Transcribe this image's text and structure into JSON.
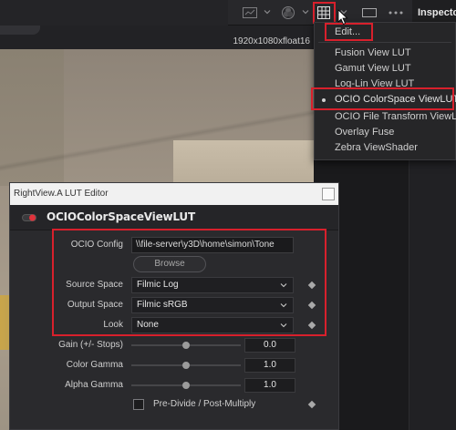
{
  "toolbar": {
    "inspector_label": "Inspecto",
    "icons": [
      "histogram-icon",
      "color-wheel-icon",
      "lut-grid-icon",
      "aspect-frame-icon",
      "more-icon"
    ],
    "accent_color": "#d8202c"
  },
  "viewer": {
    "resolution": "1920x1080xfloat16"
  },
  "lut_menu": {
    "items": [
      {
        "label": "Edit...",
        "selected": false
      },
      {
        "label": "Fusion View LUT",
        "selected": false
      },
      {
        "label": "Gamut View LUT",
        "selected": false
      },
      {
        "label": "Log-Lin View LUT",
        "selected": false
      },
      {
        "label": "OCIO ColorSpace ViewLUT",
        "selected": true
      },
      {
        "label": "OCIO File Transform ViewLUT",
        "selected": false
      },
      {
        "label": "Overlay Fuse",
        "selected": false
      },
      {
        "label": "Zebra ViewShader",
        "selected": false
      }
    ]
  },
  "editor": {
    "window_title": "RightView.A LUT Editor",
    "tool_name": "OCIOColorSpaceViewLUT",
    "ocio_config_label": "OCIO Config",
    "ocio_config_value": "\\\\file-server\\y3D\\home\\simon\\Tone",
    "browse_label": "Browse",
    "source_space_label": "Source Space",
    "source_space_value": "Filmic Log",
    "output_space_label": "Output Space",
    "output_space_value": "Filmic sRGB",
    "look_label": "Look",
    "look_value": "None",
    "gain_label": "Gain (+/- Stops)",
    "gain_value": "0.0",
    "gain_level": 0.5,
    "color_gamma_label": "Color Gamma",
    "color_gamma_value": "1.0",
    "color_gamma_level": 0.5,
    "alpha_gamma_label": "Alpha Gamma",
    "alpha_gamma_value": "1.0",
    "alpha_gamma_level": 0.5,
    "predivide_label": "Pre-Divide / Post-Multiply",
    "predivide_checked": false
  }
}
